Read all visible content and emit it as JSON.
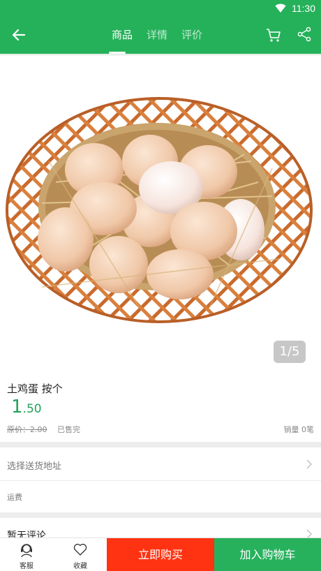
{
  "status": {
    "time": "11:30"
  },
  "header": {
    "tabs": [
      {
        "label": "商品",
        "active": true
      },
      {
        "label": "详情",
        "active": false
      },
      {
        "label": "评价",
        "active": false
      }
    ],
    "color": "#25b15a"
  },
  "gallery": {
    "counter": "1/5"
  },
  "product": {
    "title": "土鸡蛋  按个",
    "price_int": "1",
    "price_dec": ".50",
    "original_label": "原价：",
    "original_price": "2.00",
    "stock_status": "已售完",
    "sales": "销量 0笔"
  },
  "delivery": {
    "address_label": "选择送货地址",
    "freight_label": "运费"
  },
  "reviews": {
    "label": "暂无评论"
  },
  "bottom": {
    "service_label": "客服",
    "favorite_label": "收藏",
    "buy_now": "立即购买",
    "add_to_cart": "加入购物车",
    "buy_color": "#ff3312",
    "cart_color": "#27b15d"
  }
}
